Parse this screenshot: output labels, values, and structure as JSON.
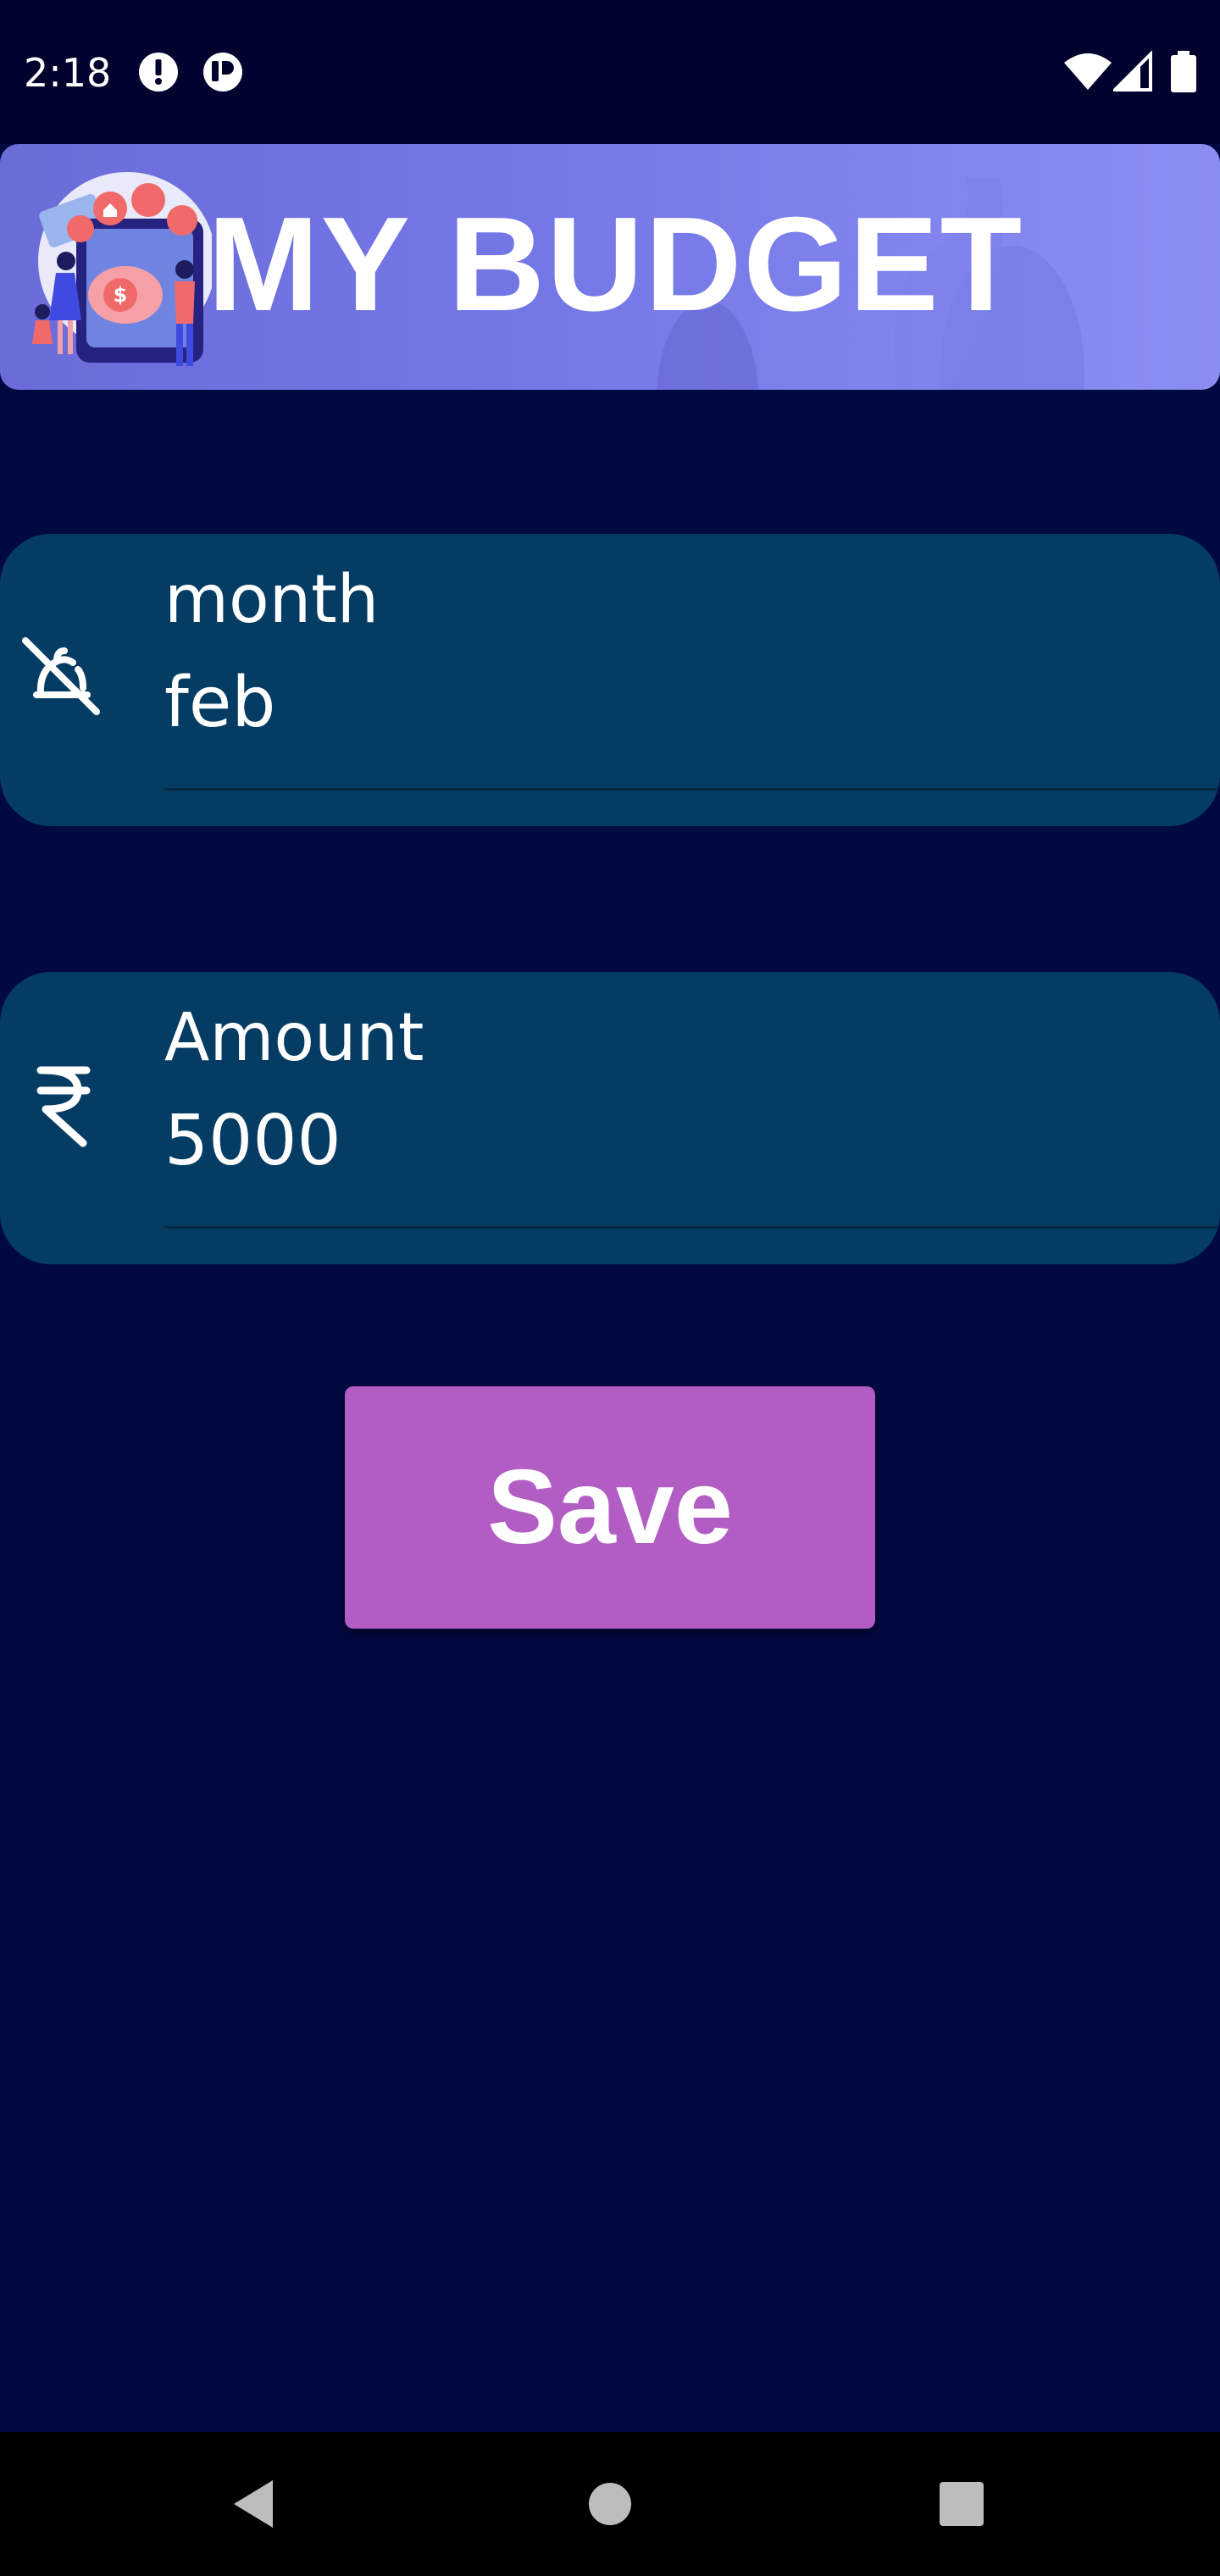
{
  "status_bar": {
    "time": "2:18",
    "left_icons": [
      "alert-icon",
      "app-notification-icon"
    ],
    "right_icons": [
      "wifi-icon",
      "cell-signal-icon",
      "battery-icon"
    ]
  },
  "header": {
    "title": "MY BUDGET",
    "illustration": "family-budget-illustration"
  },
  "form": {
    "month": {
      "label": "month",
      "value": "feb",
      "icon": "no-month-icon"
    },
    "amount": {
      "label": "Amount",
      "value": "5000",
      "icon": "rupee-icon"
    }
  },
  "actions": {
    "save_label": "Save"
  },
  "nav_bar": {
    "buttons": [
      "back-icon",
      "home-icon",
      "recents-icon"
    ]
  },
  "colors": {
    "background": "#000940",
    "status_bar": "#01022e",
    "field": "#043c63",
    "button": "#b25dc4",
    "header_start": "#6a6cd8",
    "header_end": "#8a8df2"
  }
}
